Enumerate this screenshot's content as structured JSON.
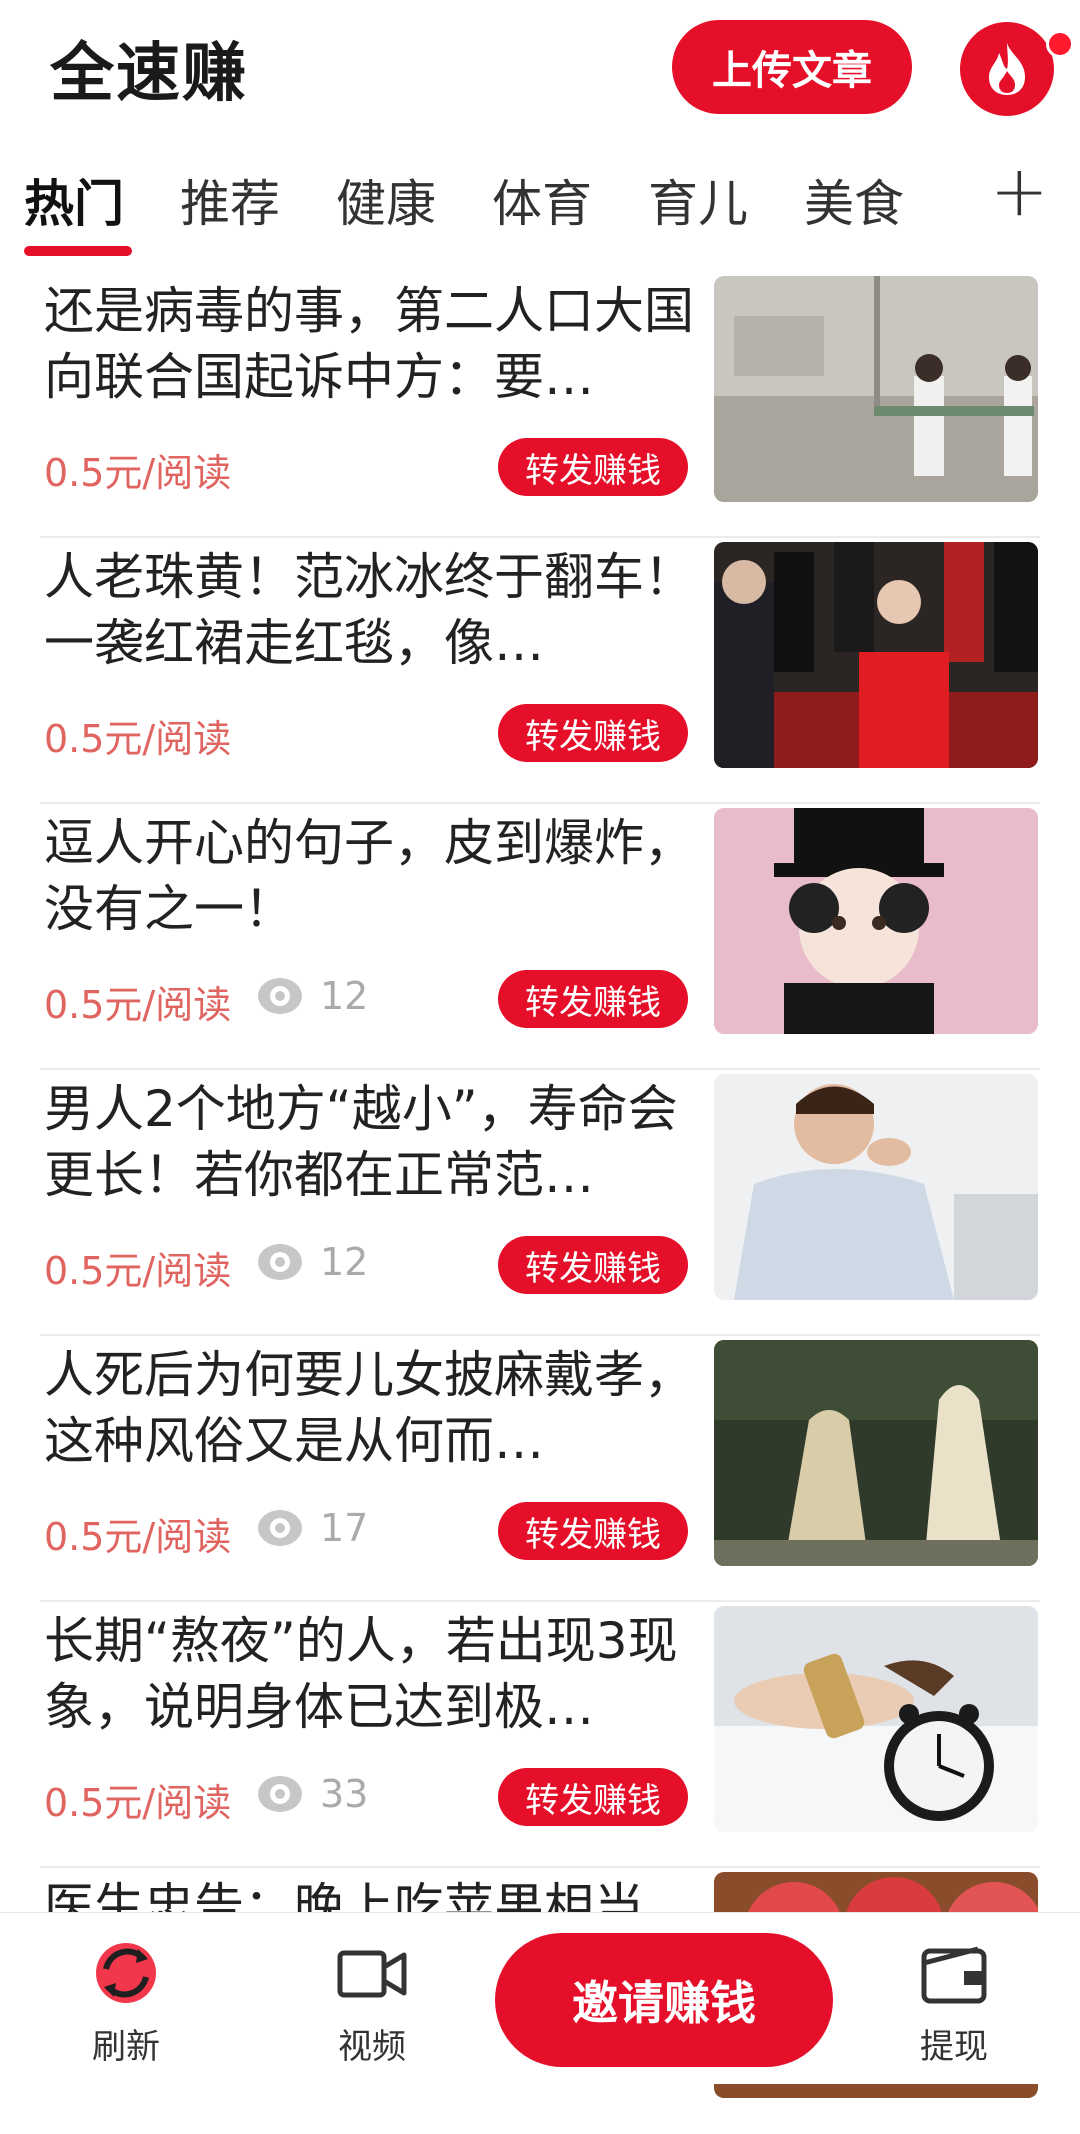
{
  "header": {
    "title": "全速赚",
    "upload_label": "上传文章",
    "brand_color": "#e50f2a"
  },
  "tabs": [
    {
      "label": "热门",
      "active": true
    },
    {
      "label": "推荐"
    },
    {
      "label": "健康"
    },
    {
      "label": "体育"
    },
    {
      "label": "育儿"
    },
    {
      "label": "美食"
    }
  ],
  "tabs_add_label": "+",
  "articles": [
    {
      "title": "还是病毒的事，第二人口大国向联合国起诉中方：要…",
      "price": "0.5元/阅读",
      "views": "",
      "share_label": "转发赚钱"
    },
    {
      "title": "人老珠黄！范冰冰终于翻车！一袭红裙走红毯，像…",
      "price": "0.5元/阅读",
      "views": "",
      "share_label": "转发赚钱"
    },
    {
      "title": "逗人开心的句子，皮到爆炸，没有之一！",
      "price": "0.5元/阅读",
      "views": "12",
      "share_label": "转发赚钱"
    },
    {
      "title": "男人2个地方“越小”，寿命会更长！若你都在正常范…",
      "price": "0.5元/阅读",
      "views": "12",
      "share_label": "转发赚钱"
    },
    {
      "title": "人死后为何要儿女披麻戴孝，这种风俗又是从何而…",
      "price": "0.5元/阅读",
      "views": "17",
      "share_label": "转发赚钱"
    },
    {
      "title": "长期“熬夜”的人，若出现3现象，说明身体已达到极…",
      "price": "0.5元/阅读",
      "views": "33",
      "share_label": "转发赚钱"
    },
    {
      "title": "医生忠告：晚上吃苹果相当",
      "price": "",
      "views": "",
      "share_label": ""
    }
  ],
  "bottom_nav": {
    "refresh_label": "刷新",
    "video_label": "视频",
    "invite_label": "邀请赚钱",
    "withdraw_label": "提现"
  }
}
